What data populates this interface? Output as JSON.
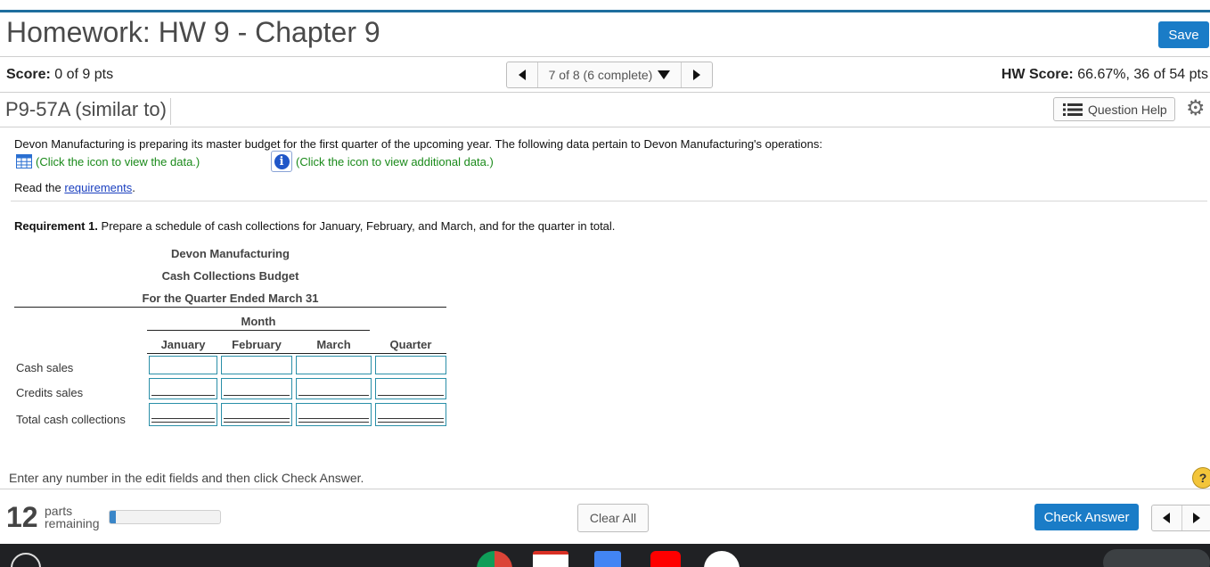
{
  "header": {
    "title": "Homework: HW 9 - Chapter 9",
    "save_label": "Save"
  },
  "score_bar": {
    "score_label": "Score:",
    "score_value": "0 of 9 pts",
    "nav_text": "7 of 8 (6 complete)",
    "hw_score_label": "HW Score:",
    "hw_score_value": "66.67%, 36 of 54 pts"
  },
  "question_bar": {
    "question_id": "P9-57A (similar to)",
    "question_help_label": "Question Help"
  },
  "problem": {
    "intro": "Devon Manufacturing is preparing its master budget for the first quarter of the upcoming year. The following data pertain to Devon Manufacturing's operations:",
    "data_link": "(Click the icon to view the data.)",
    "additional_link": "(Click the icon to view additional data.)",
    "read_prefix": "Read the ",
    "requirements_link": "requirements",
    "read_suffix": ".",
    "req1_bold": "Requirement 1.",
    "req1_text": " Prepare a schedule of cash collections for January, February, and March, and for the quarter in total."
  },
  "schedule": {
    "company": "Devon Manufacturing",
    "title": "Cash Collections Budget",
    "period": "For the Quarter Ended March 31",
    "month_header": "Month",
    "columns": [
      "January",
      "February",
      "March",
      "Quarter"
    ],
    "rows": [
      {
        "label": "Cash sales",
        "values": [
          "",
          "",
          "",
          ""
        ]
      },
      {
        "label": "Credits sales",
        "values": [
          "",
          "",
          "",
          ""
        ]
      },
      {
        "label": "Total cash collections",
        "values": [
          "",
          "",
          "",
          ""
        ]
      }
    ]
  },
  "footer": {
    "instruction": "Enter any number in the edit fields and then click Check Answer.",
    "parts_count": "12",
    "parts_word1": "parts",
    "parts_word2": "remaining",
    "progress_fraction": 0.06,
    "clear_all_label": "Clear All",
    "check_answer_label": "Check Answer"
  },
  "colors": {
    "accent": "#1a7cc7",
    "link_green": "#1a8a1a",
    "top_rule": "#1e6e9e"
  }
}
